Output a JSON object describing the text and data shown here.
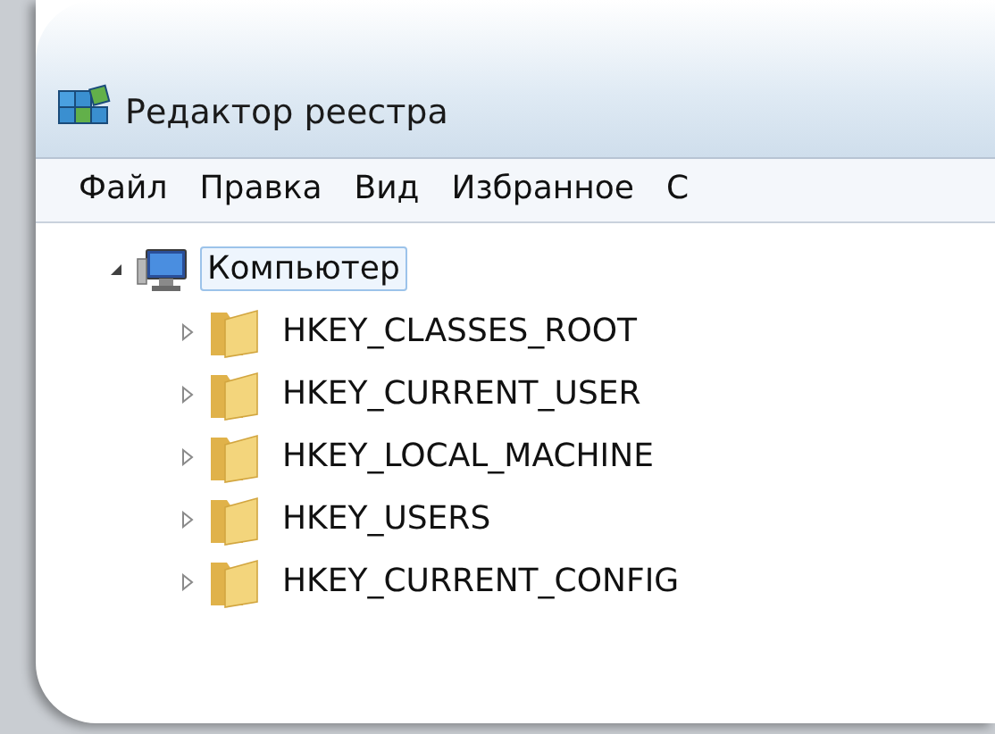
{
  "window": {
    "title": "Редактор реестра"
  },
  "menu": [
    {
      "label": "Файл"
    },
    {
      "label": "Правка"
    },
    {
      "label": "Вид"
    },
    {
      "label": "Избранное"
    },
    {
      "label": "С"
    }
  ],
  "tree": [
    {
      "label": "Компьютер",
      "kind": "computer",
      "expanded": true,
      "selected": true,
      "children": [
        {
          "label": "HKEY_CLASSES_ROOT",
          "kind": "folder",
          "expanded": false,
          "selected": false
        },
        {
          "label": "HKEY_CURRENT_USER",
          "kind": "folder",
          "expanded": false,
          "selected": false
        },
        {
          "label": "HKEY_LOCAL_MACHINE",
          "kind": "folder",
          "expanded": false,
          "selected": false
        },
        {
          "label": "HKEY_USERS",
          "kind": "folder",
          "expanded": false,
          "selected": false
        },
        {
          "label": "HKEY_CURRENT_CONFIG",
          "kind": "folder",
          "expanded": false,
          "selected": false
        }
      ]
    }
  ]
}
